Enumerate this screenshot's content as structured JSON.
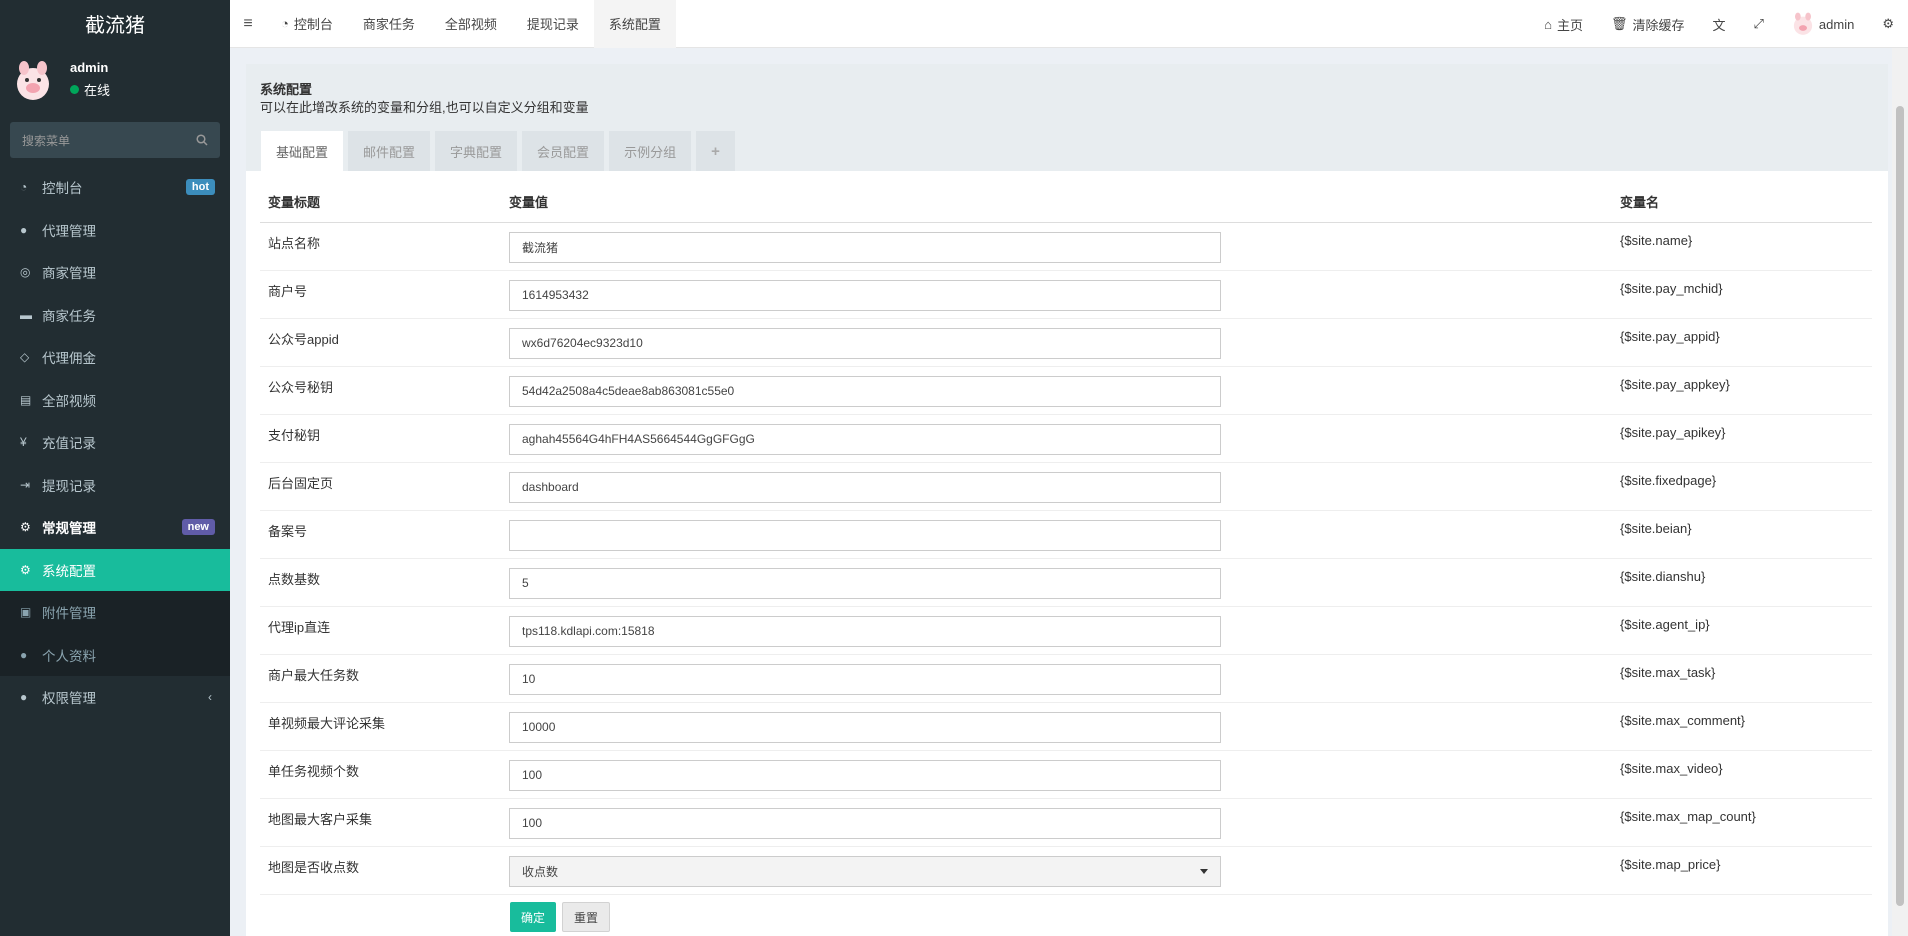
{
  "sidebar": {
    "logo": "截流猪",
    "user": {
      "name": "admin",
      "status": "在线"
    },
    "search_placeholder": "搜索菜单",
    "items": [
      {
        "label": "控制台",
        "badge": "hot"
      },
      {
        "label": "代理管理"
      },
      {
        "label": "商家管理"
      },
      {
        "label": "商家任务"
      },
      {
        "label": "代理佣金"
      },
      {
        "label": "全部视频"
      },
      {
        "label": "充值记录"
      },
      {
        "label": "提现记录"
      },
      {
        "label": "常规管理",
        "badge": "new"
      },
      {
        "label": "系统配置"
      },
      {
        "label": "附件管理"
      },
      {
        "label": "个人资料"
      },
      {
        "label": "权限管理"
      }
    ]
  },
  "topbar": {
    "tabs": [
      "控制台",
      "商家任务",
      "全部视频",
      "提现记录",
      "系统配置"
    ],
    "home": "主页",
    "clear_cache": "清除缓存",
    "user": "admin"
  },
  "panel": {
    "title": "系统配置",
    "description": "可以在此增改系统的变量和分组,也可以自定义分组和变量",
    "tabs": [
      "基础配置",
      "邮件配置",
      "字典配置",
      "会员配置",
      "示例分组",
      "+"
    ]
  },
  "table": {
    "headers": [
      "变量标题",
      "变量值",
      "变量名"
    ],
    "rows": [
      {
        "title": "站点名称",
        "value": "截流猪",
        "var": "{$site.name}"
      },
      {
        "title": "商户号",
        "value": "1614953432",
        "var": "{$site.pay_mchid}"
      },
      {
        "title": "公众号appid",
        "value": "wx6d76204ec9323d10",
        "var": "{$site.pay_appid}"
      },
      {
        "title": "公众号秘钥",
        "value": "54d42a2508a4c5deae8ab863081c55e0",
        "var": "{$site.pay_appkey}"
      },
      {
        "title": "支付秘钥",
        "value": "aghah45564G4hFH4AS5664544GgGFGgG",
        "var": "{$site.pay_apikey}"
      },
      {
        "title": "后台固定页",
        "value": "dashboard",
        "var": "{$site.fixedpage}"
      },
      {
        "title": "备案号",
        "value": "",
        "var": "{$site.beian}"
      },
      {
        "title": "点数基数",
        "value": "5",
        "var": "{$site.dianshu}"
      },
      {
        "title": "代理ip直连",
        "value": "tps118.kdlapi.com:15818",
        "var": "{$site.agent_ip}"
      },
      {
        "title": "商户最大任务数",
        "value": "10",
        "var": "{$site.max_task}"
      },
      {
        "title": "单视频最大评论采集",
        "value": "10000",
        "var": "{$site.max_comment}"
      },
      {
        "title": "单任务视频个数",
        "value": "100",
        "var": "{$site.max_video}"
      },
      {
        "title": "地图最大客户采集",
        "value": "100",
        "var": "{$site.max_map_count}"
      },
      {
        "title": "地图是否收点数",
        "value": "收点数",
        "var": "{$site.map_price}"
      }
    ]
  },
  "actions": {
    "submit": "确定",
    "reset": "重置"
  },
  "colors": {
    "sidebar_bg": "#222d32",
    "accent": "#18bc9c",
    "hot_badge": "#3c8dbc",
    "new_badge": "#605ca8"
  }
}
